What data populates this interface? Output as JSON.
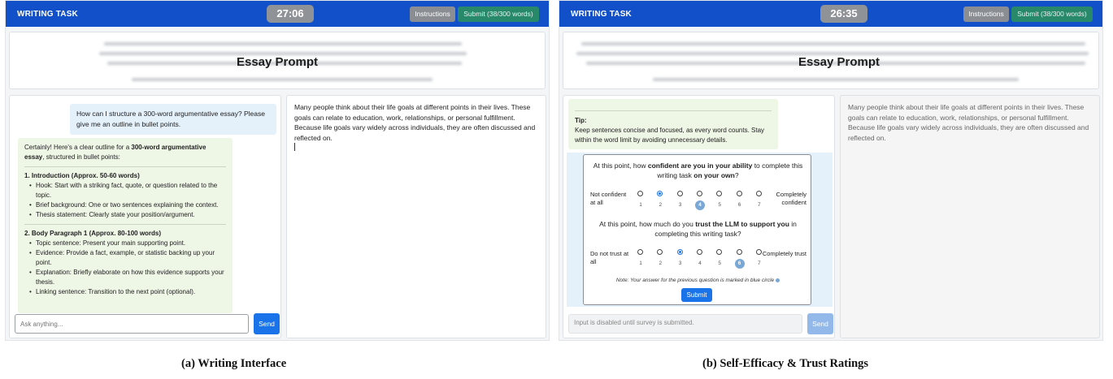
{
  "colors": {
    "topbar": "#1150c8",
    "accent": "#1a73e8",
    "submit_green": "#27886a",
    "user_bubble": "#e4f1fb",
    "ai_bubble": "#eef6e6"
  },
  "panel_a": {
    "app_title": "WRITING TASK",
    "timer": "27:06",
    "instructions_label": "Instructions",
    "submit_label": "Submit (38/300 words)",
    "prompt_title": "Essay Prompt",
    "user_message": "How can I structure a 300-word argumentative essay? Please give me an outline in bullet points.",
    "ai_intro_prefix": "Certainly! Here's a clear outline for a ",
    "ai_intro_bold": "300-word argumentative essay",
    "ai_intro_suffix": ", structured in bullet points:",
    "ai_sections": [
      {
        "heading": "1. Introduction (Approx. 50-60 words)",
        "bullets": [
          "Hook: Start with a striking fact, quote, or question related to the topic.",
          "Brief background: One or two sentences explaining the context.",
          "Thesis statement: Clearly state your position/argument."
        ]
      },
      {
        "heading": "2. Body Paragraph 1 (Approx. 80-100 words)",
        "bullets": [
          "Topic sentence: Present your main supporting point.",
          "Evidence: Provide a fact, example, or statistic backing up your point.",
          "Explanation: Briefly elaborate on how this evidence supports your thesis.",
          "Linking sentence: Transition to the next point (optional)."
        ]
      }
    ],
    "chat_placeholder": "Ask anything...",
    "send_label": "Send",
    "editor_text": "Many people think about their life goals at different points in their lives. These goals can relate to education, work, relationships, or personal fulfillment. Because life goals vary widely across individuals, they are often discussed and reflected on.",
    "caption": "(a) Writing Interface"
  },
  "panel_b": {
    "app_title": "WRITING TASK",
    "timer": "26:35",
    "instructions_label": "Instructions",
    "submit_label": "Submit (38/300 words)",
    "prompt_title": "Essay Prompt",
    "tip_label": "Tip:",
    "tip_text": "Keep sentences concise and focused, as every word counts. Stay within the word limit by avoiding unnecessary details.",
    "survey": {
      "q1": {
        "pre": "At this point, how ",
        "b1": "confident are you in your ability",
        "mid": " to complete this writing task ",
        "b2": "on your own",
        "post": "?",
        "left": "Not confident at all",
        "right": "Completely confident",
        "selected": 2,
        "previous": 4
      },
      "q2": {
        "pre": "At this point, how much do you ",
        "b1": "trust the LLM to support you",
        "mid": " in completing this writing task?",
        "left": "Do not trust at all",
        "right": "Completely trust",
        "selected": 3,
        "previous": 6
      },
      "scale": [
        "1",
        "2",
        "3",
        "4",
        "5",
        "6",
        "7"
      ],
      "note": "Note: Your answer for the previous question is marked in blue circle",
      "submit_label": "Submit"
    },
    "disabled_placeholder": "Input is disabled until survey is submitted.",
    "send_label": "Send",
    "editor_text": "Many people think about their life goals at different points in their lives. These goals can relate to education, work, relationships, or personal fulfillment. Because life goals vary widely across individuals, they are often discussed and reflected on.",
    "caption": "(b) Self-Efficacy & Trust Ratings"
  }
}
